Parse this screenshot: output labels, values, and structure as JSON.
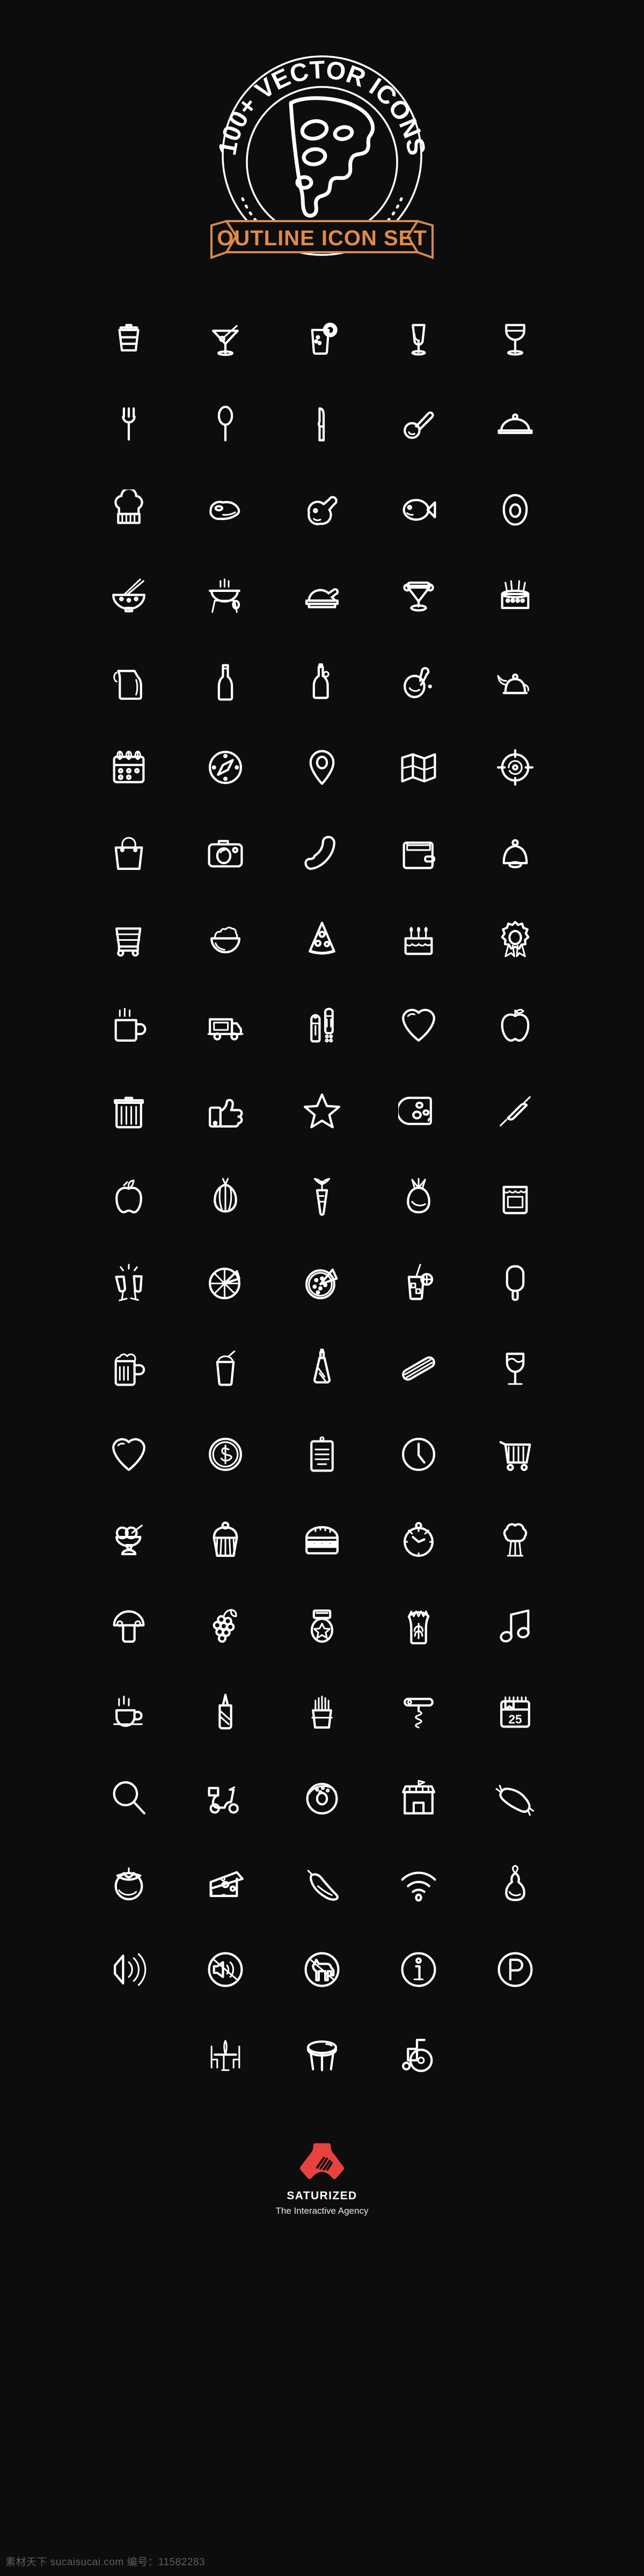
{
  "page": {
    "background_color": "#0d0d0d",
    "icon_stroke_color": "#ffffff",
    "accent_color": "#e08b4a",
    "logo_color": "#e8423f"
  },
  "header": {
    "circular_text": "100+ VECTOR ICONS",
    "ribbon_text": "OUTLINE ICON SET",
    "center_icon": "pizza-slice-icon"
  },
  "grid": {
    "columns": 5,
    "rows": [
      {
        "icons": [
          {
            "name": "coffee-cup-togo-icon",
            "label": "Takeaway coffee cup"
          },
          {
            "name": "martini-glass-icon",
            "label": "Martini cocktail glass"
          },
          {
            "name": "soda-glass-lemon-icon",
            "label": "Soda glass with lemon"
          },
          {
            "name": "champagne-flute-icon",
            "label": "Champagne flute"
          },
          {
            "name": "wine-glass-icon",
            "label": "Wine glass"
          }
        ]
      },
      {
        "icons": [
          {
            "name": "fork-icon",
            "label": "Fork"
          },
          {
            "name": "spoon-icon",
            "label": "Spoon"
          },
          {
            "name": "knife-icon",
            "label": "Knife"
          },
          {
            "name": "pizza-cutter-icon",
            "label": "Pizza cutter"
          },
          {
            "name": "cloche-food-cover-icon",
            "label": "Serving cloche"
          }
        ]
      },
      {
        "icons": [
          {
            "name": "chef-hat-icon",
            "label": "Chef hat"
          },
          {
            "name": "steak-icon",
            "label": "Steak"
          },
          {
            "name": "chicken-leg-icon",
            "label": "Chicken drumstick"
          },
          {
            "name": "fish-icon",
            "label": "Fish"
          },
          {
            "name": "avocado-icon",
            "label": "Avocado half"
          }
        ]
      },
      {
        "icons": [
          {
            "name": "noodle-bowl-icon",
            "label": "Noodle bowl with chopsticks"
          },
          {
            "name": "bbq-grill-icon",
            "label": "Barbecue grill"
          },
          {
            "name": "roast-turkey-icon",
            "label": "Roast turkey on platter"
          },
          {
            "name": "ice-cream-sundae-icon",
            "label": "Ice cream sundae cup"
          },
          {
            "name": "layer-cake-icon",
            "label": "Cake with candles"
          }
        ]
      },
      {
        "icons": [
          {
            "name": "pitcher-jug-icon",
            "label": "Water pitcher"
          },
          {
            "name": "wine-bottle-icon",
            "label": "Wine bottle"
          },
          {
            "name": "oil-bottle-icon",
            "label": "Olive oil bottle"
          },
          {
            "name": "cherry-fruit-icon",
            "label": "Cherry fruit"
          },
          {
            "name": "teapot-icon",
            "label": "Teapot"
          }
        ]
      },
      {
        "icons": [
          {
            "name": "calendar-icon",
            "label": "Calendar"
          },
          {
            "name": "compass-icon",
            "label": "Compass"
          },
          {
            "name": "location-pin-icon",
            "label": "Location pin"
          },
          {
            "name": "folded-map-icon",
            "label": "Folded map"
          },
          {
            "name": "target-icon",
            "label": "Target crosshair"
          }
        ]
      },
      {
        "icons": [
          {
            "name": "shopping-bag-icon",
            "label": "Shopping bag"
          },
          {
            "name": "camera-icon",
            "label": "Camera"
          },
          {
            "name": "phone-handset-icon",
            "label": "Telephone handset"
          },
          {
            "name": "wallet-icon",
            "label": "Wallet"
          },
          {
            "name": "bell-icon",
            "label": "Service bell"
          }
        ]
      },
      {
        "icons": [
          {
            "name": "shopping-cart-icon",
            "label": "Shopping cart"
          },
          {
            "name": "salad-bowl-icon",
            "label": "Salad bowl"
          },
          {
            "name": "pizza-slice-icon",
            "label": "Pizza slice"
          },
          {
            "name": "birthday-cake-icon",
            "label": "Birthday cake"
          },
          {
            "name": "award-rosette-icon",
            "label": "Award rosette"
          }
        ]
      },
      {
        "icons": [
          {
            "name": "hot-mug-icon",
            "label": "Steaming mug"
          },
          {
            "name": "food-truck-icon",
            "label": "Food truck"
          },
          {
            "name": "salt-pepper-shakers-icon",
            "label": "Salt and pepper shakers"
          },
          {
            "name": "heart-icon",
            "label": "Heart"
          },
          {
            "name": "apple-icon",
            "label": "Apple"
          }
        ]
      },
      {
        "icons": [
          {
            "name": "trash-can-icon",
            "label": "Trash can"
          },
          {
            "name": "thumbs-up-icon",
            "label": "Thumbs up"
          },
          {
            "name": "star-icon",
            "label": "Star"
          },
          {
            "name": "cheese-wheel-icon",
            "label": "Cheese wheel"
          },
          {
            "name": "rolling-pin-icon",
            "label": "Rolling pin"
          }
        ]
      },
      {
        "icons": [
          {
            "name": "bell-pepper-icon",
            "label": "Bell pepper"
          },
          {
            "name": "onion-icon",
            "label": "Onion"
          },
          {
            "name": "carrot-icon",
            "label": "Carrot"
          },
          {
            "name": "eggplant-icon",
            "label": "Eggplant"
          },
          {
            "name": "jam-jar-icon",
            "label": "Jam jar"
          }
        ]
      },
      {
        "icons": [
          {
            "name": "cheers-toast-icon",
            "label": "Toasting glasses"
          },
          {
            "name": "lemon-slice-icon",
            "label": "Lemon slice"
          },
          {
            "name": "whole-pizza-icon",
            "label": "Whole pizza with slice"
          },
          {
            "name": "iced-drink-icon",
            "label": "Iced drink with straw"
          },
          {
            "name": "popsicle-icon",
            "label": "Popsicle"
          }
        ]
      },
      {
        "icons": [
          {
            "name": "beer-mug-icon",
            "label": "Beer mug"
          },
          {
            "name": "milkshake-icon",
            "label": "Milkshake with straw"
          },
          {
            "name": "ketchup-bottle-icon",
            "label": "Ketchup bottle"
          },
          {
            "name": "hot-dog-icon",
            "label": "Hot dog"
          },
          {
            "name": "white-wine-glass-icon",
            "label": "White wine glass"
          }
        ]
      },
      {
        "icons": [
          {
            "name": "heart-outline-icon",
            "label": "Heart outline"
          },
          {
            "name": "dollar-coin-icon",
            "label": "Dollar coin"
          },
          {
            "name": "receipt-icon",
            "label": "Receipt bill"
          },
          {
            "name": "clock-icon",
            "label": "Clock"
          },
          {
            "name": "shopping-trolley-icon",
            "label": "Shopping trolley"
          }
        ]
      },
      {
        "icons": [
          {
            "name": "ice-cream-cup-icon",
            "label": "Ice cream cup with spoon"
          },
          {
            "name": "cupcake-icon",
            "label": "Cupcake"
          },
          {
            "name": "hamburger-icon",
            "label": "Hamburger"
          },
          {
            "name": "stopwatch-icon",
            "label": "Stopwatch"
          },
          {
            "name": "broccoli-icon",
            "label": "Broccoli"
          }
        ]
      },
      {
        "icons": [
          {
            "name": "mushroom-icon",
            "label": "Mushroom"
          },
          {
            "name": "grapes-icon",
            "label": "Grapes"
          },
          {
            "name": "medal-icon",
            "label": "Star medal"
          },
          {
            "name": "wheat-sack-icon",
            "label": "Wheat sack"
          },
          {
            "name": "music-note-icon",
            "label": "Music note"
          }
        ]
      },
      {
        "icons": [
          {
            "name": "coffee-cup-saucer-icon",
            "label": "Coffee cup and saucer"
          },
          {
            "name": "squeeze-bottle-icon",
            "label": "Squeeze sauce bottle"
          },
          {
            "name": "french-fries-icon",
            "label": "French fries"
          },
          {
            "name": "corkscrew-icon",
            "label": "Corkscrew"
          },
          {
            "name": "calendar-date-icon",
            "label": "Calendar date 25",
            "value": "25"
          }
        ]
      },
      {
        "icons": [
          {
            "name": "magnifier-icon",
            "label": "Magnifying glass"
          },
          {
            "name": "scooter-delivery-icon",
            "label": "Delivery scooter"
          },
          {
            "name": "donut-icon",
            "label": "Donut"
          },
          {
            "name": "shop-storefront-icon",
            "label": "Shop storefront"
          },
          {
            "name": "sausage-icon",
            "label": "Sausage"
          }
        ]
      },
      {
        "icons": [
          {
            "name": "tomato-icon",
            "label": "Tomato"
          },
          {
            "name": "cheese-block-icon",
            "label": "Cheese block"
          },
          {
            "name": "chili-pepper-icon",
            "label": "Chili pepper"
          },
          {
            "name": "wifi-icon",
            "label": "Wi-Fi signal"
          },
          {
            "name": "pear-icon",
            "label": "Pear"
          }
        ]
      },
      {
        "icons": [
          {
            "name": "volume-on-icon",
            "label": "Volume on"
          },
          {
            "name": "volume-muted-icon",
            "label": "No sound"
          },
          {
            "name": "no-pets-icon",
            "label": "No pets allowed"
          },
          {
            "name": "info-icon",
            "label": "Information"
          },
          {
            "name": "parking-icon",
            "label": "Parking"
          }
        ]
      },
      {
        "icons": [
          {
            "name": "table-chairs-icon",
            "label": "Table and chairs"
          },
          {
            "name": "bar-stool-icon",
            "label": "Bar stool"
          },
          {
            "name": "wheelchair-icon",
            "label": "Wheelchair access"
          }
        ]
      }
    ]
  },
  "footer": {
    "brand": "SATURIZED",
    "tagline": "The Interactive Agency",
    "logo_icon": "saturized-logo-icon"
  },
  "watermark": {
    "text": "素材天下 sucaisucai.com  编号：11582283"
  }
}
